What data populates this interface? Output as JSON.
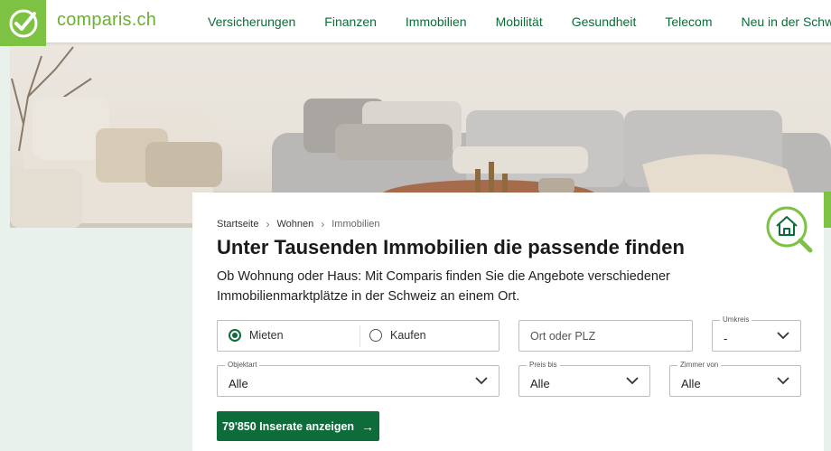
{
  "header": {
    "logo_text": "comparis.ch",
    "nav": [
      "Versicherungen",
      "Finanzen",
      "Immobilien",
      "Mobilität",
      "Gesundheit",
      "Telecom",
      "Neu in der Schweiz"
    ]
  },
  "breadcrumb": [
    "Startseite",
    "Wohnen",
    "Immobilien"
  ],
  "page": {
    "title": "Unter Tausenden Immobilien die passende finden",
    "lead": "Ob Wohnung oder Haus: Mit Comparis finden Sie die Angebote verschiedener Immobilienmarktplätze in der Schweiz an einem Ort."
  },
  "search": {
    "mode_options": [
      "Mieten",
      "Kaufen"
    ],
    "mode_selected": "Mieten",
    "location_placeholder": "Ort oder PLZ",
    "radius": {
      "label": "Umkreis",
      "value": "-"
    },
    "object_type": {
      "label": "Objektart",
      "value": "Alle"
    },
    "price_to": {
      "label": "Preis bis",
      "value": "Alle"
    },
    "rooms_from": {
      "label": "Zimmer von",
      "value": "Alle"
    },
    "submit_label": "79'850 Inserate anzeigen"
  },
  "colors": {
    "brand_green": "#7dc242",
    "dark_green": "#0e6b3a"
  }
}
